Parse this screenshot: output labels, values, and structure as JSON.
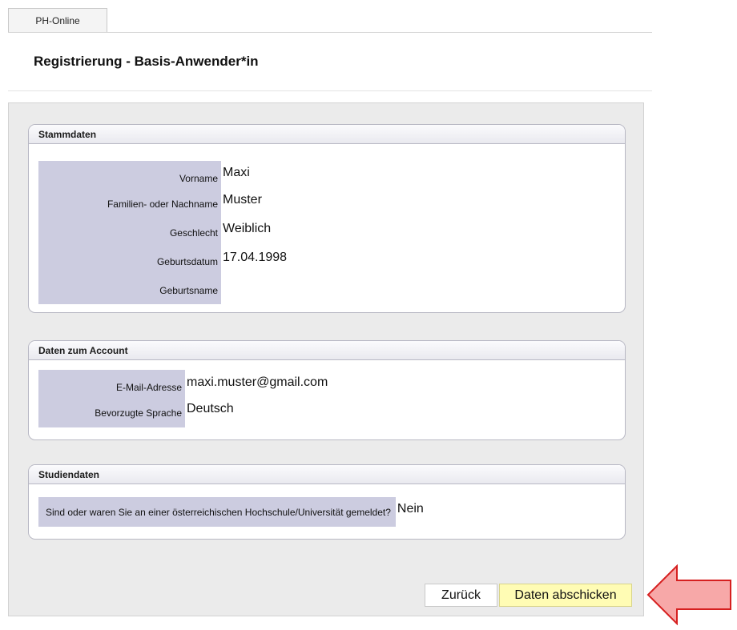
{
  "tab": {
    "label": "PH-Online"
  },
  "header": {
    "title": "Registrierung - Basis-Anwender*in"
  },
  "sections": {
    "stammdaten": {
      "title": "Stammdaten",
      "fields": [
        {
          "label": "Vorname",
          "value": "Maxi"
        },
        {
          "label": "Familien- oder Nachname",
          "value": "Muster"
        },
        {
          "label": "Geschlecht",
          "value": "Weiblich"
        },
        {
          "label": "Geburtsdatum",
          "value": "17.04.1998"
        },
        {
          "label": "Geburtsname",
          "value": ""
        }
      ]
    },
    "account": {
      "title": "Daten zum Account",
      "fields": [
        {
          "label": "E-Mail-Adresse",
          "value": "maxi.muster@gmail.com"
        },
        {
          "label": "Bevorzugte Sprache",
          "value": "Deutsch"
        }
      ]
    },
    "studien": {
      "title": "Studiendaten",
      "fields": [
        {
          "label": "Sind oder waren Sie an einer österreichischen Hochschule/Universität gemeldet?",
          "value": "Nein"
        }
      ]
    }
  },
  "buttons": {
    "back": "Zurück",
    "submit": "Daten abschicken"
  },
  "colors": {
    "label_bg": "#cccce0",
    "submit_bg": "#fffcb4",
    "arrow": "#f7a8a8",
    "arrow_border": "#d62020"
  },
  "icons": {
    "arrow": "left-arrow-icon"
  }
}
